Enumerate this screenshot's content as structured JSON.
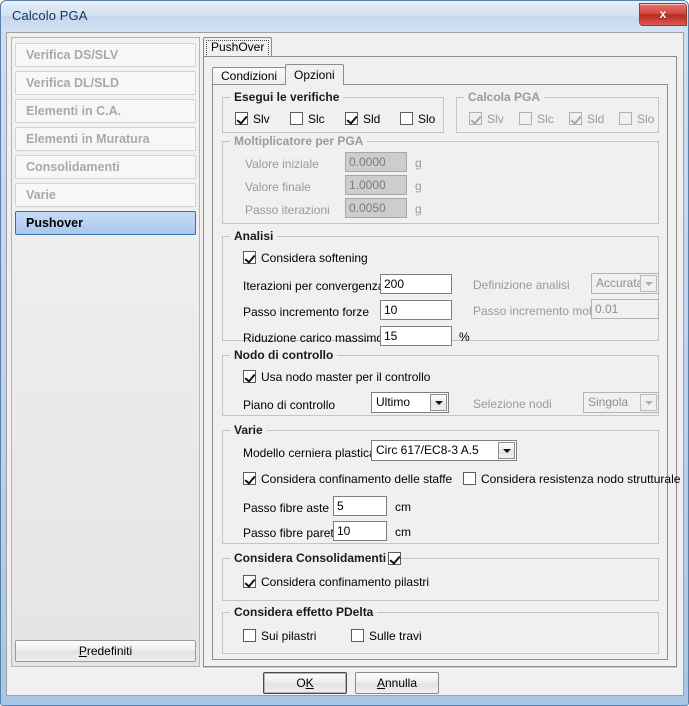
{
  "window": {
    "title": "Calcolo PGA",
    "close_label": "x"
  },
  "sidebar": {
    "items": [
      {
        "label": "Verifica DS/SLV",
        "selected": false
      },
      {
        "label": "Verifica DL/SLD",
        "selected": false
      },
      {
        "label": "Elementi in C.A.",
        "selected": false
      },
      {
        "label": "Elementi in Muratura",
        "selected": false
      },
      {
        "label": "Consolidamenti",
        "selected": false
      },
      {
        "label": "Varie",
        "selected": false
      },
      {
        "label": "Pushover",
        "selected": true
      }
    ],
    "defaults_button": "Predefiniti"
  },
  "outer_tab": {
    "label": "PushOver"
  },
  "inner_tabs": [
    {
      "label": "Condizioni",
      "active": false
    },
    {
      "label": "Opzioni",
      "active": true
    }
  ],
  "groups": {
    "esegui": {
      "legend": "Esegui le verifiche",
      "checks": [
        {
          "label": "Slv",
          "checked": true,
          "disabled": false
        },
        {
          "label": "Slc",
          "checked": false,
          "disabled": false
        },
        {
          "label": "Sld",
          "checked": true,
          "disabled": false
        },
        {
          "label": "Slo",
          "checked": false,
          "disabled": false
        }
      ]
    },
    "calcola_pga": {
      "legend": "Calcola PGA",
      "checks": [
        {
          "label": "Slv",
          "checked": true,
          "disabled": true
        },
        {
          "label": "Slc",
          "checked": false,
          "disabled": true
        },
        {
          "label": "Sld",
          "checked": true,
          "disabled": true
        },
        {
          "label": "Slo",
          "checked": false,
          "disabled": true
        }
      ]
    },
    "moltiplicatore": {
      "legend": "Moltiplicatore per PGA",
      "rows": [
        {
          "label": "Valore iniziale",
          "value": "0.0000",
          "unit": "g"
        },
        {
          "label": "Valore finale",
          "value": "1.0000",
          "unit": "g"
        },
        {
          "label": "Passo iterazioni",
          "value": "0.0050",
          "unit": "g"
        }
      ]
    },
    "analisi": {
      "legend": "Analisi",
      "softening": {
        "label": "Considera softening",
        "checked": true
      },
      "iterazioni": {
        "label": "Iterazioni per convergenza",
        "value": "200"
      },
      "passo_forze": {
        "label": "Passo incremento forze",
        "value": "10"
      },
      "riduzione": {
        "label": "Riduzione carico massimo",
        "value": "15",
        "unit": "%"
      },
      "definizione": {
        "label": "Definizione analisi",
        "value": "Accurata"
      },
      "passo_molt": {
        "label": "Passo incremento molt.",
        "value": "0.01"
      }
    },
    "nodo": {
      "legend": "Nodo di controllo",
      "usa_master": {
        "label": "Usa nodo master per il controllo",
        "checked": true
      },
      "piano": {
        "label": "Piano di controllo",
        "value": "Ultimo"
      },
      "selezione": {
        "label": "Selezione nodi",
        "value": "Singola"
      }
    },
    "varie": {
      "legend": "Varie",
      "modello": {
        "label": "Modello cerniera plastica",
        "value": "Circ 617/EC8-3 A.5"
      },
      "confinamento_staffe": {
        "label": "Considera confinamento delle staffe",
        "checked": true
      },
      "resistenza_nodo": {
        "label": "Considera resistenza nodo strutturale",
        "checked": false
      },
      "fibre_aste": {
        "label": "Passo fibre aste",
        "value": "5",
        "unit": "cm"
      },
      "fibre_pareti": {
        "label": "Passo fibre pareti",
        "value": "10",
        "unit": "cm"
      }
    },
    "consolidamenti": {
      "legend": "Considera Consolidamenti",
      "legend_checked": true,
      "confinamento_pilastri": {
        "label": "Considera confinamento pilastri",
        "checked": true
      }
    },
    "pdelta": {
      "legend": "Considera effetto PDelta",
      "sui_pilastri": {
        "label": "Sui pilastri",
        "checked": false
      },
      "sulle_travi": {
        "label": "Sulle travi",
        "checked": false
      }
    }
  },
  "footer": {
    "ok": "OK",
    "cancel": "Annulla"
  }
}
